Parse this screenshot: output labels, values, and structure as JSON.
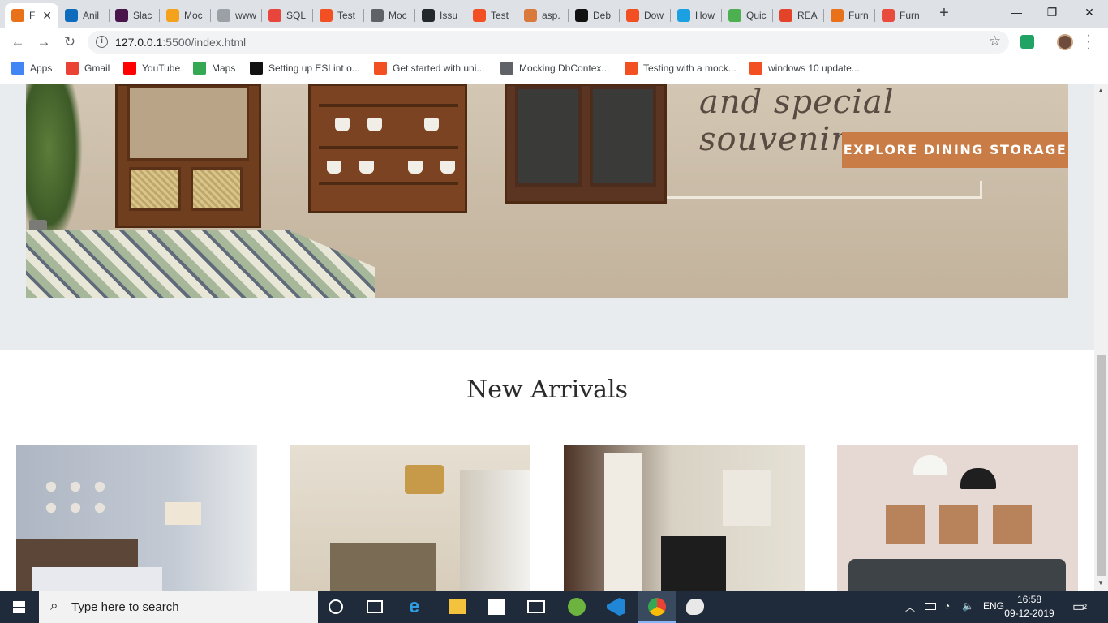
{
  "browser": {
    "tabs": [
      {
        "title": "F",
        "color": "#e8711a",
        "active": true
      },
      {
        "title": "Anil",
        "color": "#0f6cbd"
      },
      {
        "title": "Slac",
        "color": "#4a154b"
      },
      {
        "title": "Moc",
        "color": "#f4a21b"
      },
      {
        "title": "www",
        "color": "#9aa0a6"
      },
      {
        "title": "SQL",
        "color": "#e8453c"
      },
      {
        "title": "Test",
        "color": "#f25022"
      },
      {
        "title": "Moc",
        "color": "#5f6368"
      },
      {
        "title": "Issu",
        "color": "#24292e"
      },
      {
        "title": "Test",
        "color": "#f25022"
      },
      {
        "title": "asp.",
        "color": "#d97a3a"
      },
      {
        "title": "Deb",
        "color": "#111111"
      },
      {
        "title": "Dow",
        "color": "#f25022"
      },
      {
        "title": "How",
        "color": "#1ba1e2"
      },
      {
        "title": "Quic",
        "color": "#4caf50"
      },
      {
        "title": "REA",
        "color": "#e24329"
      },
      {
        "title": "Furn",
        "color": "#e8711a"
      },
      {
        "title": "Furn",
        "color": "#e94b3c"
      }
    ],
    "active_tab_close": "✕",
    "new_tab": "+",
    "window_controls": {
      "minimize": "—",
      "maximize": "❐",
      "close": "✕"
    },
    "nav": {
      "back": "←",
      "forward": "→",
      "reload": "↻"
    },
    "url": {
      "host": "127.0.0.1",
      "rest": ":5500/index.html"
    },
    "bookmarks": [
      {
        "label": "Apps",
        "color": "#4285f4"
      },
      {
        "label": "Gmail",
        "color": "#ea4335"
      },
      {
        "label": "YouTube",
        "color": "#ff0000"
      },
      {
        "label": "Maps",
        "color": "#34a853"
      },
      {
        "label": "Setting up ESLint o...",
        "color": "#111111"
      },
      {
        "label": "Get started with uni...",
        "color": "#f25022"
      },
      {
        "label": "Mocking DbContex...",
        "color": "#5f6368"
      },
      {
        "label": "Testing with a mock...",
        "color": "#f25022"
      },
      {
        "label": "windows 10 update...",
        "color": "#f25022"
      }
    ]
  },
  "page": {
    "hero": {
      "tagline": "and special souvenirs",
      "cta_label": "EXPLORE DINING STORAGE"
    },
    "section_title": "New Arrivals",
    "cards": [
      "bedroom-image",
      "bedroom-hotel-image",
      "tv-unit-image",
      "living-room-sofa-image"
    ]
  },
  "taskbar": {
    "search_placeholder": "Type here to search",
    "tray_lang": "ENG",
    "time": "16:58",
    "date": "09-12-2019",
    "notifications": "2"
  }
}
